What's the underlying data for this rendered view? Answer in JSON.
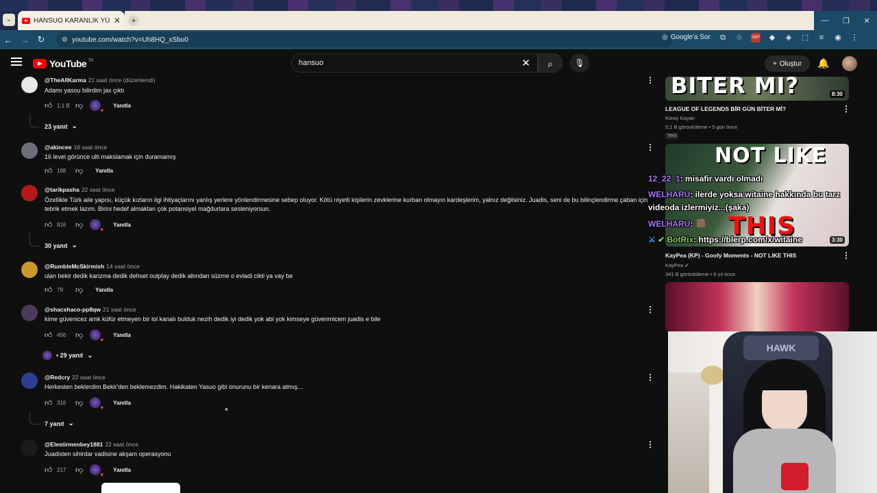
{
  "browser": {
    "tab_title": "HANSUO KARANLIK YÜZÜ",
    "tab_close": "✕",
    "new_tab": "+",
    "url": "youtube.com/watch?v=Uh8HQ_xSbo0",
    "google_ask": "Google'a Sor",
    "window_controls": [
      "—",
      "❐",
      "✕"
    ]
  },
  "youtube": {
    "logo_text": "YouTube",
    "region": "TR",
    "search_value": "hansuo",
    "create_label": "Oluştur"
  },
  "comments": [
    {
      "author": "@TheAllKarma",
      "time": "21 saat önce (düzenlendi)",
      "text": "Adamı yasou bilirdim jax çıktı",
      "likes": "1,1 B",
      "reply": "Yanıtla",
      "heart": true,
      "replies_label": "23 yanıt"
    },
    {
      "author": "@akincee",
      "time": "16 saat önce",
      "text": "16 level görünce ulti makslamak için duramamış",
      "likes": "188",
      "reply": "Yanıtla",
      "heart": false,
      "replies_label": ""
    },
    {
      "author": "@tarikpasha",
      "time": "22 saat önce",
      "text": "Özellikle Türk aile yapısı, küçük kızların ilgi ihtiyaçlarını yanlış yerlere yönlendirmesine sebep oluyor. Kötü niyetli kişilerin zevklerine kurban olmayın kardeşlerim, yalnız değilsiniz. Juadis, seni de bu bilinçlendirme çaban için tebrik etmek lazım. Birini hedef almaktan çok potansiyel mağdurlara sesleniyorsun.",
      "likes": "816",
      "reply": "Yanıtla",
      "heart": true,
      "replies_label": "30 yanıt"
    },
    {
      "author": "@RumbleMcSkirmish",
      "time": "14 saat önce",
      "text": "ulan bekir dedik karizma dedik dehset outplay dedik altından süzme o evladi cikti ya vay be",
      "likes": "79",
      "reply": "Yanıtla",
      "heart": false,
      "replies_label": ""
    },
    {
      "author": "@shacshaco-pp8qw",
      "time": "21 saat önce",
      "text": "kime güvenicez amk küfür etmeyen bir lol kanalı bulduk nezih dedik iyi dedik yok abi yok kimseye güvenmicem juadis e bile",
      "likes": "456",
      "reply": "Yanıtla",
      "heart": true,
      "replies_label": "• 29 yanıt"
    },
    {
      "author": "@Redcry",
      "time": "22 saat önce",
      "text": "Herkesten beklerdim Bekir'den beklemezdim. Hakikaten Yasuo gibi onurunu bir kenara atmış...",
      "likes": "316",
      "reply": "Yanıtla",
      "heart": true,
      "replies_label": "7 yanıt"
    },
    {
      "author": "@Elestirmenbey1881",
      "time": "22 saat önce",
      "text": "Juadisten sihirdar vadisine akşam operasyonu",
      "likes": "217",
      "reply": "Yanıtla",
      "heart": true,
      "replies_label": ""
    }
  ],
  "sidebar": [
    {
      "thumb_text": "BITER Mİ?",
      "duration": "8:30",
      "title": "LEAGUE OF LEGENDS BİR GÜN BİTER Mİ?",
      "channel": "Koray Kayan",
      "meta": "5,1 B görüntüleme • 5 gün önce",
      "badge": "Yeni"
    },
    {
      "thumb_text": "NOT LIKE",
      "thumb_text2": "THIS",
      "duration": "3:30",
      "title": "KayPea (KP) - Goofy Moments - NOT LIKE THIS",
      "channel": "KayPea",
      "meta": "341 B görüntüleme • 8 yıl önce",
      "badge": ""
    },
    {
      "thumb_text": "",
      "duration": "",
      "title": "",
      "channel": "",
      "meta": "",
      "badge": ""
    }
  ],
  "chat": [
    {
      "user": "12_22_1",
      "text": ": misafir vardı olmadı"
    },
    {
      "user": "WELHARU",
      "text": ": ilerde yoksa witaine hakkında bu tarz"
    },
    {
      "user": "",
      "text": "videoda izlermiyiz...(şaka)"
    },
    {
      "user": "WELHARU",
      "text": ": "
    },
    {
      "user": "BotRix",
      "text": ": https://blerp.com/x/witaine"
    }
  ],
  "webcam": {
    "chair_text": "HAWK"
  },
  "colors": {
    "accent": "#ff0000",
    "background": "#0f0f0f",
    "chat_user": "#a974ff",
    "chat_bot": "#8bd14b"
  }
}
